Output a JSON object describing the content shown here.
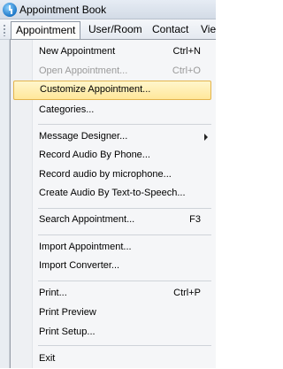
{
  "window": {
    "title": "Appointment Book"
  },
  "menubar": {
    "items": [
      "Appointment",
      "User/Room",
      "Contact",
      "Vie"
    ]
  },
  "menu": {
    "items": [
      {
        "label": "New Appointment",
        "shortcut": "Ctrl+N"
      },
      {
        "label": "Open Appointment...",
        "shortcut": "Ctrl+O",
        "disabled": true
      },
      {
        "label": "Customize Appointment...",
        "highlighted": true
      },
      {
        "label": "Categories..."
      },
      {
        "label": "Message Designer...",
        "submenu": true
      },
      {
        "label": "Record Audio By Phone..."
      },
      {
        "label": "Record audio by microphone..."
      },
      {
        "label": "Create Audio By Text-to-Speech..."
      },
      {
        "label": "Search Appointment...",
        "shortcut": "F3"
      },
      {
        "label": "Import Appointment..."
      },
      {
        "label": "Import Converter..."
      },
      {
        "label": "Print...",
        "shortcut": "Ctrl+P"
      },
      {
        "label": "Print Preview"
      },
      {
        "label": "Print Setup..."
      },
      {
        "label": "Exit"
      }
    ]
  },
  "colors": {
    "highlight_fill": "#ffe79a",
    "highlight_border": "#e3b44c",
    "disabled_text": "#9a9a9a",
    "menu_background": "#f5f6f8"
  },
  "icons": [
    "app-icon",
    "submenu-arrow-icon"
  ]
}
